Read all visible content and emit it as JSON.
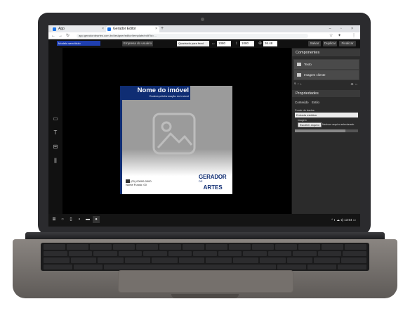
{
  "browser": {
    "tabs": [
      {
        "label": "App"
      },
      {
        "label": "Gerador Editor"
      }
    ],
    "new_tab": "+",
    "window_controls": "– ▫ ×",
    "url": "app.geradordeartes.com.br/designer/editor/template/edit?id=...",
    "nav": {
      "back": "←",
      "forward": "→",
      "reload": "↻"
    }
  },
  "toolbar": {
    "name_value": "Modelo sem título",
    "empresa_button": "Empresa do usuário",
    "dims_select": "Quadrado para feed",
    "width_value": "1080",
    "height_value": "1080",
    "zoom_value": "36.48",
    "buttons": [
      "Salvar",
      "Duplicar",
      "Finalizar"
    ]
  },
  "artwork": {
    "title": "Nome do imóvel",
    "subtitle": "Endereço/informação do imóvel",
    "contact_line1": "(00) 00000-0000",
    "contact_line2": "Nome Fundo: 00",
    "logo_top": "GERADOR",
    "logo_de": "DE",
    "logo_bottom": "ARTES"
  },
  "components": {
    "heading": "Componentes",
    "items": [
      {
        "label": "Texto"
      },
      {
        "label": "Imagem cliente"
      }
    ],
    "actions": "⇡ ↑ ↓",
    "actions_right": "⇼ ⇔"
  },
  "properties": {
    "heading": "Propriedades",
    "tabs": [
      "Conteúdo",
      "Estilo"
    ],
    "ds_label": "Fonte de dados",
    "ds_value": "Entrada estática",
    "image_label": "Imagem",
    "file_button": "Escolher arquivo",
    "file_text": "Nenhum arquivo selecionado"
  },
  "taskbar": {
    "time": "13:54",
    "tray": "^ ◐ ☁ ◂)"
  },
  "colors": {
    "brand_blue": "#0f2d73",
    "name_input_bg": "#1f3fb0"
  }
}
